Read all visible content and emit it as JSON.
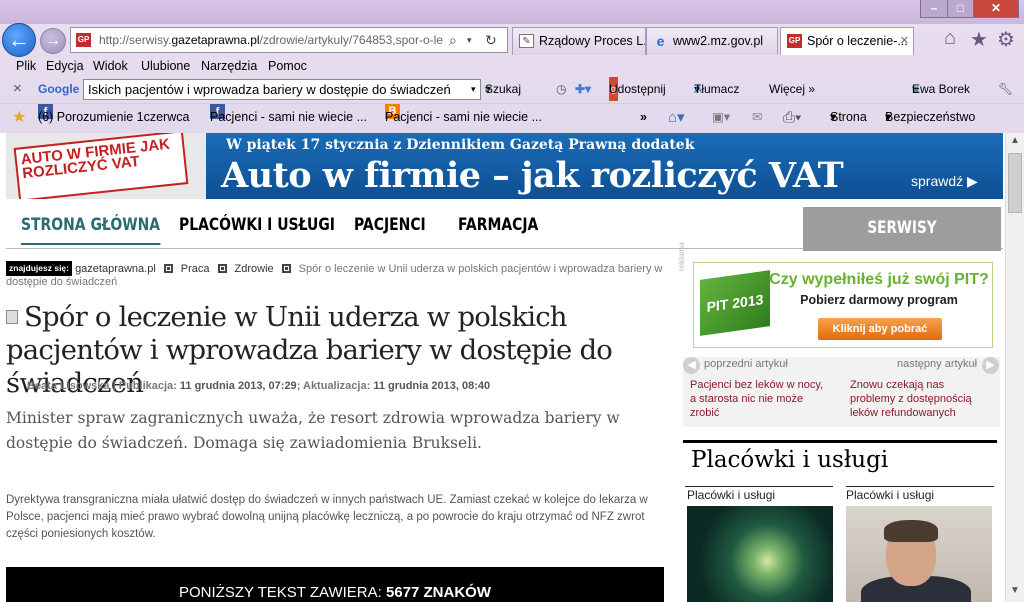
{
  "window": {
    "minimize": "–",
    "maximize": "□",
    "close": "✕"
  },
  "address": {
    "favicon": "GP",
    "url_prefix": "http://serwisy.",
    "url_domain": "gazetaprawna.pl",
    "url_rest": "/zdrowie/artykuly/764853,spor-o-le"
  },
  "tabs": [
    {
      "label": "Rządowy Proces L...",
      "icon": "document-icon"
    },
    {
      "label": "www2.mz.gov.pl",
      "icon": "ie-icon"
    },
    {
      "label": "Spór o leczenie-...",
      "icon": "gp-icon",
      "active": true,
      "close": "✕"
    }
  ],
  "menu": [
    "Plik",
    "Edycja",
    "Widok",
    "Ulubione",
    "Narzędzia",
    "Pomoc"
  ],
  "google_bar": {
    "close": "×",
    "brand": "Google",
    "query": "Iskich pacjentów i wprowadza bariery w dostępie do świadczeń",
    "search": "Szukaj",
    "share": "Udostępnij",
    "translate": "Tłumacz",
    "more": "Więcej »",
    "user": "Ewa Borek"
  },
  "favorites": {
    "items": [
      "(6) Porozumienie 1czerwca",
      "Pacjenci - sami nie wiecie ...",
      "Pacjenci - sami nie wiecie ..."
    ],
    "overflow": "»",
    "page": "Strona",
    "security": "Bezpieczeństwo"
  },
  "banner": {
    "image_text": "AUTO W FIRMIE JAK ROZLICZYĆ VAT",
    "sub": "W piątek 17 stycznia z Dziennikiem Gazetą Prawną dodatek",
    "title": "Auto w firmie – jak rozliczyć VAT",
    "cta": "sprawdź"
  },
  "nav": {
    "items": [
      "STRONA GŁÓWNA",
      "PLACÓWKI I USŁUGI",
      "PACJENCI",
      "FARMACJA"
    ],
    "themed": "SERWISY TEMATYCZNE"
  },
  "breadcrumb": {
    "tag": "znajdujesz się:",
    "items": [
      "gazetaprawna.pl",
      "Praca",
      "Zdrowie"
    ],
    "current": "Spór o leczenie w Unii uderza w polskich pacjentów i wprowadza bariery w dostępie do świadczeń"
  },
  "article": {
    "title": "Spór o leczenie w Unii uderza w polskich pacjentów i wprowadza bariery w dostępie do świadczeń",
    "author": "Beata Lisowska",
    "pub_label": "Publikacja:",
    "pub_date": "11 grudnia 2013, 07:29",
    "upd_label": "Aktualizacja:",
    "upd_date": "11 grudnia 2013, 08:40",
    "lead": "Minister spraw zagranicznych uważa, że resort zdrowia wprowadza bariery w dostępie do świadczeń. Domaga się zawiadomienia Brukseli.",
    "body": "Dyrektywa transgraniczna miała ułatwić dostęp do świadczeń w innych państwach UE. Zamiast czekać w kolejce do lekarza w Polsce, pacjenci mają mieć prawo wybrać dowolną unijną placówkę leczniczą, a po powrocie do kraju otrzymać od NFZ zwrot części poniesionych kosztów.",
    "paywall_label": "PONIŻSZY TEKST ZAWIERA:",
    "paywall_count": "5677 ZNAKÓW"
  },
  "ad": {
    "label": "reklama",
    "badge": "PIT 2013",
    "headline": "Czy wypełniłeś już swój PIT?",
    "sub": "Pobierz darmowy program",
    "button": "Kliknij aby pobrać"
  },
  "article_nav": {
    "prev_label": "poprzedni artykuł",
    "prev_title": "Pacjenci bez leków w nocy, a starosta nic nie może zrobić",
    "next_label": "następny artykuł",
    "next_title": "Znowu czekają nas problemy z dostępnością leków refundowanych"
  },
  "side_section": {
    "title": "Placówki i usługi",
    "cats": [
      "Placówki i usługi",
      "Placówki i usługi"
    ]
  }
}
